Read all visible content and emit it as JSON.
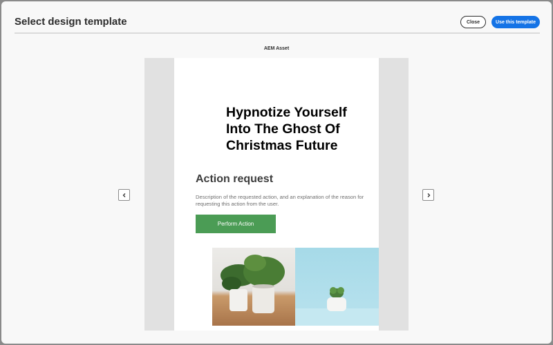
{
  "header": {
    "title": "Select design template",
    "close_label": "Close",
    "use_label": "Use this template"
  },
  "preview": {
    "asset_label": "AEM Asset",
    "headline": "Hypnotize Yourself Into The Ghost Of Christmas Future",
    "action_title": "Action request",
    "action_description": "Description of the requested action, and an explanation of the reason for requesting this action from the user.",
    "button_label": "Perform Action",
    "button_color": "#4b9c55"
  },
  "nav": {
    "prev_icon": "chevron-left-icon",
    "next_icon": "chevron-right-icon"
  },
  "colors": {
    "accent": "#1473e6"
  }
}
